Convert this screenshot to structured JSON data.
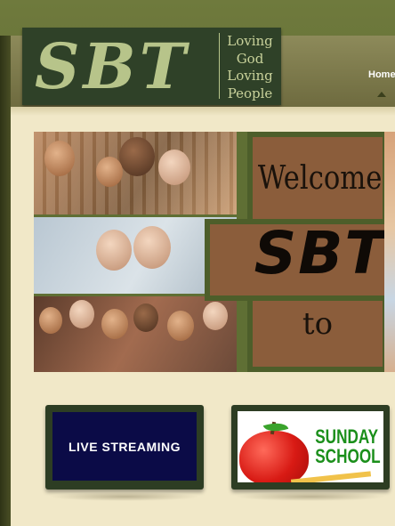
{
  "header": {
    "logo_letters": "SBT",
    "tagline": [
      "Loving",
      "God",
      "Loving",
      "People"
    ],
    "nav": {
      "home_label": "Home"
    }
  },
  "banner": {
    "welcome": "Welcome",
    "name": "SBT",
    "to": "to"
  },
  "tiles": {
    "live_streaming_label": "LIVE STREAMING",
    "sunday_school_label": "SUNDAY SCHOOL"
  },
  "colors": {
    "header_bg": "#6e6b3f",
    "logo_bg": "#2f4128",
    "logo_text": "#b7c48a",
    "content_bg": "#f1e8c8",
    "cross_brown": "#8b5d3b",
    "cross_border": "#4d5e2a",
    "live_bg": "#0b0b47",
    "sunday_green": "#1b8f1b"
  }
}
